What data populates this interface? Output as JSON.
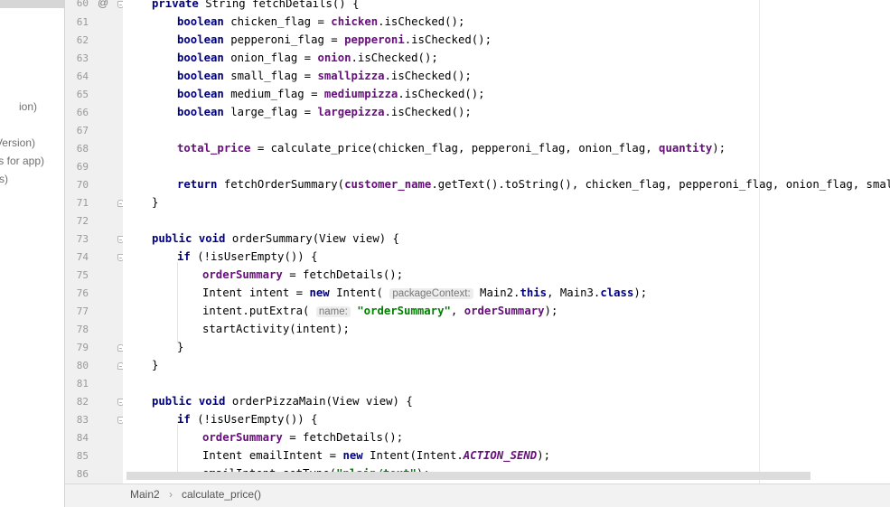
{
  "sidebar": {
    "fragments": [
      "ion)",
      "Version)",
      "s for app)",
      "s)"
    ]
  },
  "gutter": {
    "line_numbers": [
      "60",
      "61",
      "62",
      "63",
      "64",
      "65",
      "66",
      "67",
      "68",
      "69",
      "70",
      "71",
      "72",
      "73",
      "74",
      "75",
      "76",
      "77",
      "78",
      "79",
      "80",
      "81",
      "82",
      "83",
      "84",
      "85",
      "86"
    ],
    "annotation_symbol": "@"
  },
  "code": {
    "line60": {
      "t1": "private",
      "t2": " String fetchDetails() {"
    },
    "line61": {
      "t1": "boolean",
      "t2": " chicken_flag = ",
      "t3": "chicken",
      "t4": ".isChecked();"
    },
    "line62": {
      "t1": "boolean",
      "t2": " pepperoni_flag = ",
      "t3": "pepperoni",
      "t4": ".isChecked();"
    },
    "line63": {
      "t1": "boolean",
      "t2": " onion_flag = ",
      "t3": "onion",
      "t4": ".isChecked();"
    },
    "line64": {
      "t1": "boolean",
      "t2": " small_flag = ",
      "t3": "smallpizza",
      "t4": ".isChecked();"
    },
    "line65": {
      "t1": "boolean",
      "t2": " medium_flag = ",
      "t3": "mediumpizza",
      "t4": ".isChecked();"
    },
    "line66": {
      "t1": "boolean",
      "t2": " large_flag = ",
      "t3": "largepizza",
      "t4": ".isChecked();"
    },
    "line68": {
      "t1": "total_price",
      "t2": " = calculate_price(chicken_flag, pepperoni_flag, onion_flag, ",
      "t3": "quantity",
      "t4": ");"
    },
    "line70": {
      "t1": "return",
      "t2": " fetchOrderSummary(",
      "t3": "customer_name",
      "t4": ".getText().toString(), chicken_flag, pepperoni_flag, onion_flag, small_flag"
    },
    "line71": {
      "t1": "}"
    },
    "line73": {
      "t1": "public",
      "t2": " ",
      "t3": "void",
      "t4": " orderSummary(View view) {"
    },
    "line74": {
      "t1": "if",
      "t2": " (!isUserEmpty()) {"
    },
    "line75": {
      "t1": "orderSummary",
      "t2": " = fetchDetails();"
    },
    "line76": {
      "t1": "Intent intent = ",
      "t2": "new",
      "t3": " Intent( ",
      "hint": "packageContext:",
      "t4": " Main2.",
      "t5": "this",
      "t6": ", Main3.",
      "t7": "class",
      "t8": ");"
    },
    "line77": {
      "t1": "intent.putExtra( ",
      "hint": "name:",
      "t2": " ",
      "t3": "\"orderSummary\"",
      "t4": ", ",
      "t5": "orderSummary",
      "t6": ");"
    },
    "line78": {
      "t1": "startActivity(intent);"
    },
    "line79": {
      "t1": "}"
    },
    "line80": {
      "t1": "}"
    },
    "line82": {
      "t1": "public",
      "t2": " ",
      "t3": "void",
      "t4": " orderPizzaMain(View view) {"
    },
    "line83": {
      "t1": "if",
      "t2": " (!isUserEmpty()) {"
    },
    "line84": {
      "t1": "orderSummary",
      "t2": " = fetchDetails();"
    },
    "line85": {
      "t1": "Intent emailIntent = ",
      "t2": "new",
      "t3": " Intent(Intent.",
      "t4": "ACTION_SEND",
      "t5": ");"
    },
    "line86": {
      "t1": "emailIntent.setType(",
      "t2": "\"plain/text\"",
      "t3": ");"
    }
  },
  "breadcrumb": {
    "items": [
      "Main2",
      "calculate_price()"
    ],
    "separator": "›"
  },
  "colors": {
    "keyword": "#000080",
    "field": "#660e7a",
    "string": "#008000",
    "gutter_bg": "#f0f0f0",
    "status_bg": "#f2f2f2"
  }
}
